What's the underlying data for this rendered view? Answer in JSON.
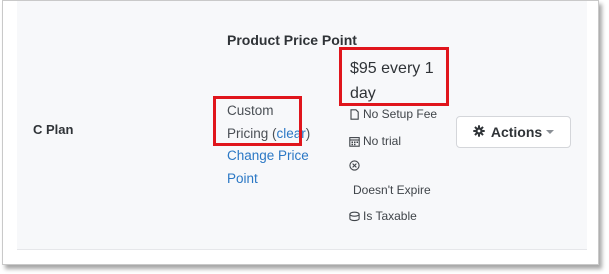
{
  "plan": {
    "name": "C Plan"
  },
  "column": {
    "title": "Product Price Point"
  },
  "pricing": {
    "label_line1": "Custom",
    "label_line2": "Pricing (",
    "clear_link": "clear",
    "close_paren": ")",
    "change_link_line1": "Change Price",
    "change_link_line2": "Point"
  },
  "price": {
    "line1": "$95 every 1",
    "line2": "day"
  },
  "details": {
    "setup_fee": "No Setup Fee",
    "trial": "No trial",
    "expire": "Doesn't Expire",
    "taxable": "Is Taxable"
  },
  "actions": {
    "label": "Actions"
  },
  "icons": {
    "setup_fee": "file-icon",
    "trial": "calendar-icon",
    "expire": "circle-x-icon",
    "taxable": "database-icon",
    "actions": "gear-icon"
  },
  "colors": {
    "link": "#2b78c5",
    "highlight": "#e0151c",
    "panel_bg": "#f7f8fa"
  }
}
